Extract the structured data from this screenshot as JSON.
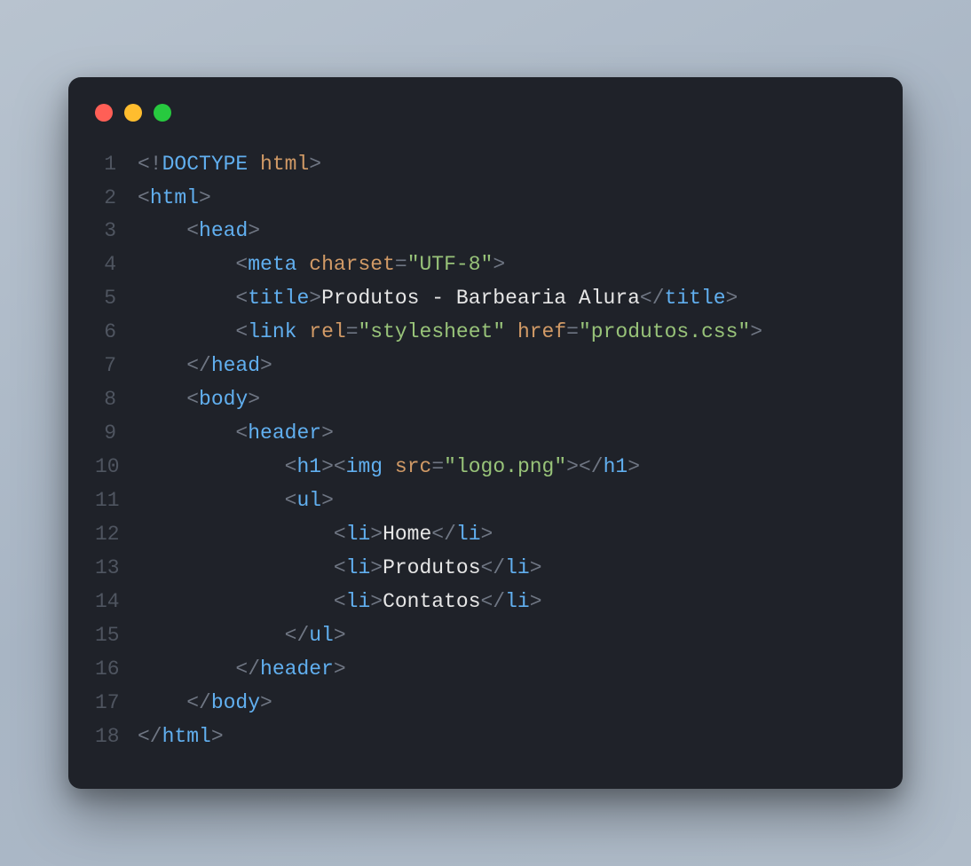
{
  "lines": [
    {
      "n": "1",
      "indent": 0,
      "tokens": [
        {
          "t": "<!",
          "c": "punct"
        },
        {
          "t": "DOCTYPE",
          "c": "tag"
        },
        {
          "t": " ",
          "c": "punct"
        },
        {
          "t": "html",
          "c": "attr"
        },
        {
          "t": ">",
          "c": "punct"
        }
      ]
    },
    {
      "n": "2",
      "indent": 0,
      "tokens": [
        {
          "t": "<",
          "c": "punct"
        },
        {
          "t": "html",
          "c": "tag"
        },
        {
          "t": ">",
          "c": "punct"
        }
      ]
    },
    {
      "n": "3",
      "indent": 1,
      "tokens": [
        {
          "t": "<",
          "c": "punct"
        },
        {
          "t": "head",
          "c": "tag"
        },
        {
          "t": ">",
          "c": "punct"
        }
      ]
    },
    {
      "n": "4",
      "indent": 2,
      "tokens": [
        {
          "t": "<",
          "c": "punct"
        },
        {
          "t": "meta",
          "c": "tag"
        },
        {
          "t": " ",
          "c": "punct"
        },
        {
          "t": "charset",
          "c": "attr"
        },
        {
          "t": "=",
          "c": "punct"
        },
        {
          "t": "\"UTF-8\"",
          "c": "str"
        },
        {
          "t": ">",
          "c": "punct"
        }
      ]
    },
    {
      "n": "5",
      "indent": 2,
      "tokens": [
        {
          "t": "<",
          "c": "punct"
        },
        {
          "t": "title",
          "c": "tag"
        },
        {
          "t": ">",
          "c": "punct"
        },
        {
          "t": "Produtos - Barbearia Alura",
          "c": "txt"
        },
        {
          "t": "</",
          "c": "punct"
        },
        {
          "t": "title",
          "c": "tag"
        },
        {
          "t": ">",
          "c": "punct"
        }
      ]
    },
    {
      "n": "6",
      "indent": 2,
      "tokens": [
        {
          "t": "<",
          "c": "punct"
        },
        {
          "t": "link",
          "c": "tag"
        },
        {
          "t": " ",
          "c": "punct"
        },
        {
          "t": "rel",
          "c": "attr"
        },
        {
          "t": "=",
          "c": "punct"
        },
        {
          "t": "\"stylesheet\"",
          "c": "str"
        },
        {
          "t": " ",
          "c": "punct"
        },
        {
          "t": "href",
          "c": "attr"
        },
        {
          "t": "=",
          "c": "punct"
        },
        {
          "t": "\"produtos.css\"",
          "c": "str"
        },
        {
          "t": ">",
          "c": "punct"
        }
      ]
    },
    {
      "n": "7",
      "indent": 1,
      "tokens": [
        {
          "t": "</",
          "c": "punct"
        },
        {
          "t": "head",
          "c": "tag"
        },
        {
          "t": ">",
          "c": "punct"
        }
      ]
    },
    {
      "n": "8",
      "indent": 1,
      "tokens": [
        {
          "t": "<",
          "c": "punct"
        },
        {
          "t": "body",
          "c": "tag"
        },
        {
          "t": ">",
          "c": "punct"
        }
      ]
    },
    {
      "n": "9",
      "indent": 2,
      "tokens": [
        {
          "t": "<",
          "c": "punct"
        },
        {
          "t": "header",
          "c": "tag"
        },
        {
          "t": ">",
          "c": "punct"
        }
      ]
    },
    {
      "n": "10",
      "indent": 3,
      "tokens": [
        {
          "t": "<",
          "c": "punct"
        },
        {
          "t": "h1",
          "c": "tag"
        },
        {
          "t": "><",
          "c": "punct"
        },
        {
          "t": "img",
          "c": "tag"
        },
        {
          "t": " ",
          "c": "punct"
        },
        {
          "t": "src",
          "c": "attr"
        },
        {
          "t": "=",
          "c": "punct"
        },
        {
          "t": "\"logo.png\"",
          "c": "str"
        },
        {
          "t": "></",
          "c": "punct"
        },
        {
          "t": "h1",
          "c": "tag"
        },
        {
          "t": ">",
          "c": "punct"
        }
      ]
    },
    {
      "n": "11",
      "indent": 3,
      "tokens": [
        {
          "t": "<",
          "c": "punct"
        },
        {
          "t": "ul",
          "c": "tag"
        },
        {
          "t": ">",
          "c": "punct"
        }
      ]
    },
    {
      "n": "12",
      "indent": 4,
      "tokens": [
        {
          "t": "<",
          "c": "punct"
        },
        {
          "t": "li",
          "c": "tag"
        },
        {
          "t": ">",
          "c": "punct"
        },
        {
          "t": "Home",
          "c": "txt"
        },
        {
          "t": "</",
          "c": "punct"
        },
        {
          "t": "li",
          "c": "tag"
        },
        {
          "t": ">",
          "c": "punct"
        }
      ]
    },
    {
      "n": "13",
      "indent": 4,
      "tokens": [
        {
          "t": "<",
          "c": "punct"
        },
        {
          "t": "li",
          "c": "tag"
        },
        {
          "t": ">",
          "c": "punct"
        },
        {
          "t": "Produtos",
          "c": "txt"
        },
        {
          "t": "</",
          "c": "punct"
        },
        {
          "t": "li",
          "c": "tag"
        },
        {
          "t": ">",
          "c": "punct"
        }
      ]
    },
    {
      "n": "14",
      "indent": 4,
      "tokens": [
        {
          "t": "<",
          "c": "punct"
        },
        {
          "t": "li",
          "c": "tag"
        },
        {
          "t": ">",
          "c": "punct"
        },
        {
          "t": "Contatos",
          "c": "txt"
        },
        {
          "t": "</",
          "c": "punct"
        },
        {
          "t": "li",
          "c": "tag"
        },
        {
          "t": ">",
          "c": "punct"
        }
      ]
    },
    {
      "n": "15",
      "indent": 3,
      "tokens": [
        {
          "t": "</",
          "c": "punct"
        },
        {
          "t": "ul",
          "c": "tag"
        },
        {
          "t": ">",
          "c": "punct"
        }
      ]
    },
    {
      "n": "16",
      "indent": 2,
      "tokens": [
        {
          "t": "</",
          "c": "punct"
        },
        {
          "t": "header",
          "c": "tag"
        },
        {
          "t": ">",
          "c": "punct"
        }
      ]
    },
    {
      "n": "17",
      "indent": 1,
      "tokens": [
        {
          "t": "</",
          "c": "punct"
        },
        {
          "t": "body",
          "c": "tag"
        },
        {
          "t": ">",
          "c": "punct"
        }
      ]
    },
    {
      "n": "18",
      "indent": 0,
      "tokens": [
        {
          "t": "</",
          "c": "punct"
        },
        {
          "t": "html",
          "c": "tag"
        },
        {
          "t": ">",
          "c": "punct"
        }
      ]
    }
  ]
}
